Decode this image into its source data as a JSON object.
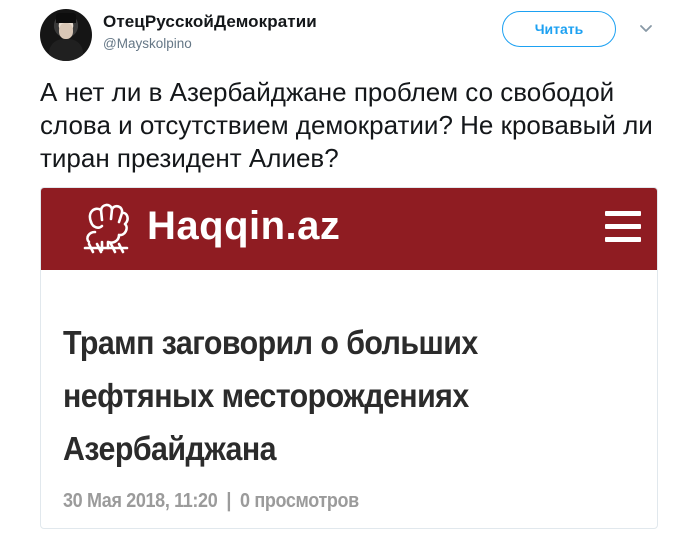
{
  "author": {
    "display_name": "ОтецРусскойДемократии",
    "handle": "@Mayskolpino"
  },
  "follow_label": "Читать",
  "tweet_text": "А нет ли в Азербайджане проблем со свободой слова и отсутствием демократии? Не кровавый ли тиран президент Алиев?",
  "card": {
    "site_name": "Haqqin.az",
    "header_color": "#8f1c22",
    "headline": "Трамп заговорил о больших нефтяных месторождениях Азербайджана",
    "date": "30 Мая 2018, 11:20",
    "separator": "|",
    "views": "0 просмотров"
  },
  "colors": {
    "accent": "#1da1f2",
    "text": "#14171a",
    "muted": "#657786"
  },
  "icons": [
    "avatar",
    "chevron-down-icon",
    "fist-logo-icon",
    "hamburger-menu-icon"
  ]
}
